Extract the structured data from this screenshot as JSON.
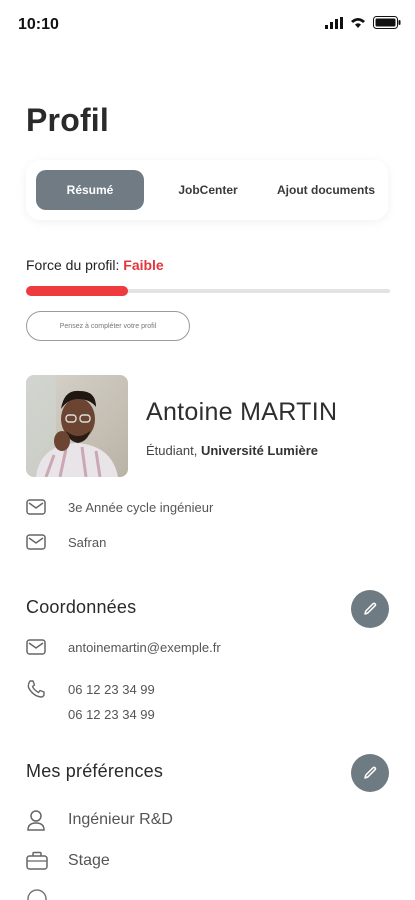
{
  "status": {
    "time": "10:10"
  },
  "page": {
    "title": "Profil"
  },
  "tabs": [
    {
      "label": "Résumé",
      "active": true
    },
    {
      "label": "JobCenter",
      "active": false
    },
    {
      "label": "Ajout documents",
      "active": false
    }
  ],
  "profile_strength": {
    "label": "Force du profil:",
    "level": "Faible",
    "progress_fraction": 0.28,
    "color": "#ee3b3f"
  },
  "hint": {
    "label": "Pensez à compléter votre profil"
  },
  "user": {
    "name": "Antoine MARTIN",
    "role": "Étudiant,",
    "school": "Université Lumière",
    "details": [
      {
        "icon": "mail-icon",
        "text": "3e Année cycle ingénieur"
      },
      {
        "icon": "mail-icon",
        "text": "Safran"
      }
    ]
  },
  "contact": {
    "title": "Coordonnées",
    "email": "antoinemartin@exemple.fr",
    "phone1": "06 12 23 34 99",
    "phone2": "06 12 23 34 99"
  },
  "preferences": {
    "title": "Mes préférences",
    "items": [
      {
        "icon": "user-icon",
        "text": "Ingénieur R&D"
      },
      {
        "icon": "briefcase-icon",
        "text": "Stage"
      }
    ]
  },
  "colors": {
    "accent": "#6f7b83",
    "danger": "#e2363c"
  }
}
